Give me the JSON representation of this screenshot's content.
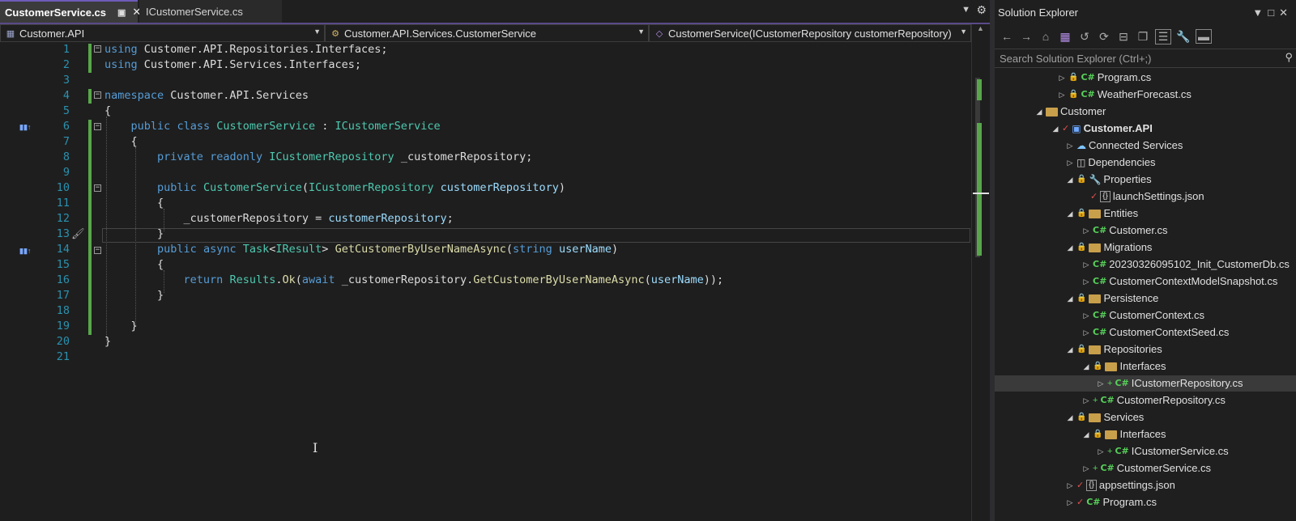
{
  "tabs": [
    {
      "label": "CustomerService.cs",
      "active": true
    },
    {
      "label": "ICustomerService.cs",
      "active": false
    }
  ],
  "navbar": {
    "project": "Customer.API",
    "class": "Customer.API.Services.CustomerService",
    "member": "CustomerService(ICustomerRepository customerRepository)"
  },
  "code": {
    "line_numbers": [
      "1",
      "2",
      "3",
      "4",
      "5",
      "6",
      "7",
      "8",
      "9",
      "10",
      "11",
      "12",
      "13",
      "14",
      "15",
      "16",
      "17",
      "18",
      "19",
      "20",
      "21"
    ],
    "lines": [
      "using Customer.API.Repositories.Interfaces;",
      "using Customer.API.Services.Interfaces;",
      "",
      "namespace Customer.API.Services",
      "{",
      "    public class CustomerService : ICustomerService",
      "    {",
      "        private readonly ICustomerRepository _customerRepository;",
      "",
      "        public CustomerService(ICustomerRepository customerRepository)",
      "        {",
      "            _customerRepository = customerRepository;",
      "        }",
      "        public async Task<IResult> GetCustomerByUserNameAsync(string userName)",
      "        {",
      "            return Results.Ok(await _customerRepository.GetCustomerByUserNameAsync(userName));",
      "        }",
      "",
      "    }",
      "}",
      ""
    ]
  },
  "solution_explorer": {
    "title": "Solution Explorer",
    "search_placeholder": "Search Solution Explorer (Ctrl+;)",
    "items": [
      {
        "label": "Program.cs",
        "icon": "csharp-icon"
      },
      {
        "label": "WeatherForecast.cs",
        "icon": "csharp-icon"
      },
      {
        "label": "Customer",
        "icon": "folder-icon"
      },
      {
        "label": "Customer.API",
        "icon": "project-icon"
      },
      {
        "label": "Connected Services",
        "icon": "connected-services-icon"
      },
      {
        "label": "Dependencies",
        "icon": "dependencies-icon"
      },
      {
        "label": "Properties",
        "icon": "properties-icon"
      },
      {
        "label": "launchSettings.json",
        "icon": "json-icon"
      },
      {
        "label": "Entities",
        "icon": "folder-icon"
      },
      {
        "label": "Customer.cs",
        "icon": "csharp-icon"
      },
      {
        "label": "Migrations",
        "icon": "folder-icon"
      },
      {
        "label": "20230326095102_Init_CustomerDb.cs",
        "icon": "csharp-icon"
      },
      {
        "label": "CustomerContextModelSnapshot.cs",
        "icon": "csharp-icon"
      },
      {
        "label": "Persistence",
        "icon": "folder-icon"
      },
      {
        "label": "CustomerContext.cs",
        "icon": "csharp-icon"
      },
      {
        "label": "CustomerContextSeed.cs",
        "icon": "csharp-icon"
      },
      {
        "label": "Repositories",
        "icon": "folder-icon"
      },
      {
        "label": "Interfaces",
        "icon": "folder-icon"
      },
      {
        "label": "ICustomerRepository.cs",
        "icon": "csharp-icon"
      },
      {
        "label": "CustomerRepository.cs",
        "icon": "csharp-icon"
      },
      {
        "label": "Services",
        "icon": "folder-icon"
      },
      {
        "label": "Interfaces",
        "icon": "folder-icon"
      },
      {
        "label": "ICustomerService.cs",
        "icon": "csharp-icon"
      },
      {
        "label": "CustomerService.cs",
        "icon": "csharp-icon"
      },
      {
        "label": "appsettings.json",
        "icon": "json-icon"
      },
      {
        "label": "Program.cs",
        "icon": "csharp-icon"
      }
    ]
  },
  "colors": {
    "accent": "#6e5bb8",
    "keyword": "#569cd6",
    "type": "#4ec9b0",
    "method": "#dcdcaa",
    "parameter": "#9cdcfe",
    "line_number": "#2b91af",
    "change_bar": "#57a64a"
  }
}
